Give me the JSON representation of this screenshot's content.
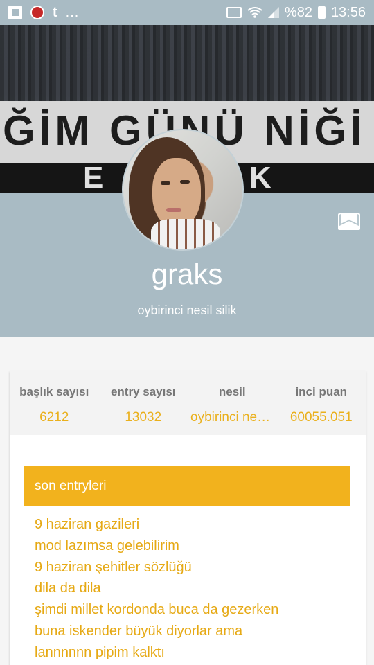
{
  "status_bar": {
    "icons_left": [
      "flipboard-icon",
      "red-app-icon",
      "tumblr-icon"
    ],
    "tumblr_glyph": "t",
    "more": "...",
    "battery": "%82",
    "time": "13:56"
  },
  "cover": {
    "banner_text": "ĞİM GÜNÜ NİĞİ",
    "lower_text": "E L K"
  },
  "profile": {
    "username": "graks",
    "tagline": "oybirinci nesil silik",
    "colors": {
      "header_bg": "#a9bbc4",
      "accent": "#f2b21d"
    }
  },
  "stats": [
    {
      "label": "başlık sayısı",
      "value": "6212"
    },
    {
      "label": "entry sayısı",
      "value": "13032"
    },
    {
      "label": "nesil",
      "value": "oybirinci nesil silik"
    },
    {
      "label": "inci puan",
      "value": "60055.051"
    }
  ],
  "recent_entries": {
    "heading": "son entryleri",
    "items": [
      "9 haziran gazileri",
      "mod lazımsa gelebilirim",
      "9 haziran şehitler sözlüğü",
      "dila da dila",
      "şimdi millet kordonda buca da gezerken",
      "buna iskender büyük diyorlar ama",
      "lannnnnn pipim kalktı"
    ]
  }
}
